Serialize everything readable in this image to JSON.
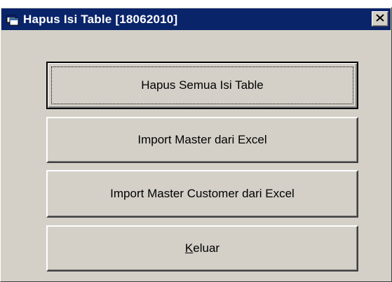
{
  "window": {
    "title": "Hapus Isi Table [18062010]",
    "icon": "app-window-icon",
    "close_icon": "close-icon"
  },
  "buttons": {
    "hapus": {
      "label": "Hapus Semua Isi Table"
    },
    "import_master": {
      "label": "Import Master dari Excel"
    },
    "import_customer": {
      "label": "Import Master Customer dari Excel"
    },
    "keluar": {
      "label_accel": "K",
      "label_rest": "eluar"
    }
  },
  "colors": {
    "titlebar": "#0a246a",
    "face": "#d4d0c8"
  }
}
